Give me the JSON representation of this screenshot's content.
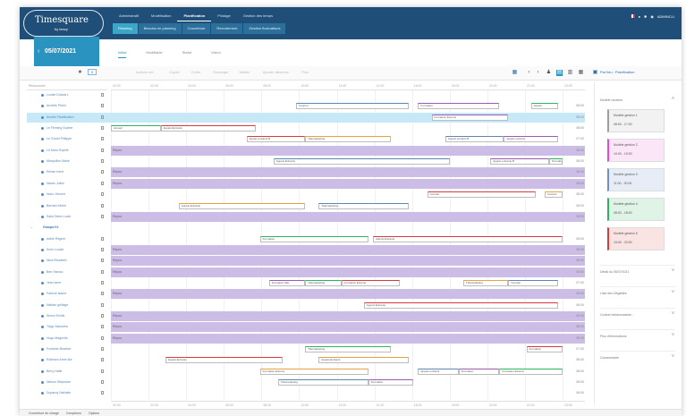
{
  "app": {
    "logo_title": "Timesquare",
    "logo_sub": "by tenzy"
  },
  "main_nav": [
    "Administratif",
    "Modélisation",
    "Planification",
    "Pilotage",
    "Gestion des temps"
  ],
  "main_nav_active": 2,
  "sub_nav": [
    "Planning",
    "Besoins en planning",
    "Couverture",
    "Recrutement",
    "Gestion fluctuations"
  ],
  "sub_nav_active": 0,
  "top_right": {
    "user": "ADMINCLI"
  },
  "date_box": {
    "date": "05/07/2021"
  },
  "view_tabs": [
    "Initial",
    "Modifiable",
    "Statut",
    "Vision"
  ],
  "view_tabs_active": 0,
  "toolbar": {
    "zoom": "5",
    "items": [
      "Actions sel.",
      "Copier",
      "Coller",
      "Echanger",
      "Valider",
      "Ajouter absence",
      "Plus"
    ],
    "right_filter": "Par lieu : Planification"
  },
  "header": {
    "resources_label": "Ressources",
    "ticks": [
      "00:00",
      "02:00",
      "04:00",
      "06:00",
      "08:00",
      "10:00",
      "12:00",
      "14:00",
      "16:00",
      "18:00",
      "20:00",
      "22:00",
      "23:59"
    ]
  },
  "resources": [
    {
      "name": "Louise Dubois L",
      "type": "person"
    },
    {
      "name": "Armelle Peres",
      "type": "person"
    },
    {
      "name": "Amélie Planification",
      "type": "person",
      "selected": true
    },
    {
      "name": "Le Fleming Sophie",
      "type": "person"
    },
    {
      "name": "Le Grand Philippe",
      "type": "person"
    },
    {
      "name": "Le Maro Sophie",
      "type": "person"
    },
    {
      "name": "Marquillon Marie",
      "type": "person"
    },
    {
      "name": "Renan Irène",
      "type": "person"
    },
    {
      "name": "Naves Julien",
      "type": "person"
    },
    {
      "name": "Noiro Vincent",
      "type": "person"
    },
    {
      "name": "Bernard Marie",
      "type": "person"
    },
    {
      "name": "Saint Denis Lucie",
      "type": "person"
    },
    {
      "name": "Groupe 01",
      "type": "group"
    },
    {
      "name": "Adèle Régine",
      "type": "person"
    },
    {
      "name": "Sven Louise",
      "type": "person"
    },
    {
      "name": "Nina Elisabeth",
      "type": "person"
    },
    {
      "name": "Ben Hamou",
      "type": "person"
    },
    {
      "name": "Jean Isere",
      "type": "person"
    },
    {
      "name": "Fabrice Isaure",
      "type": "person"
    },
    {
      "name": "Nathan grilliage",
      "type": "person"
    },
    {
      "name": "Simon Emilie",
      "type": "person"
    },
    {
      "name": "Tiago Manuella",
      "type": "person"
    },
    {
      "name": "Hugo Magnolia",
      "type": "person"
    },
    {
      "name": "Fontaine Béatrice",
      "type": "person"
    },
    {
      "name": "Rolleaux Anne Ma",
      "type": "person"
    },
    {
      "name": "Berry Halle",
      "type": "person"
    },
    {
      "name": "Nelson Stéphane",
      "type": "person"
    },
    {
      "name": "Duparcq Nathalie",
      "type": "person"
    }
  ],
  "rows": [
    {
      "hours": "",
      "band": "none",
      "events": []
    },
    {
      "hours": "08:00",
      "band": "none",
      "events": [
        {
          "label": "Courrier",
          "s": 0.41,
          "e": 0.66
        },
        {
          "label": "Formation",
          "s": 0.68,
          "e": 0.86
        },
        {
          "label": "Appels",
          "s": 0.93,
          "e": 0.99
        }
      ]
    },
    {
      "hours": "08:00",
      "band": "sel",
      "events": [
        {
          "label": "Formation Externe",
          "s": 0.71,
          "e": 0.88
        }
      ]
    },
    {
      "hours": "08:00",
      "band": "none",
      "events": [
        {
          "label": "Accueil",
          "s": 0.0,
          "e": 0.11
        },
        {
          "label": "Appels Entrants",
          "s": 0.11,
          "e": 0.32
        }
      ]
    },
    {
      "hours": "07:00",
      "band": "none",
      "events": [
        {
          "label": "Appels entrants B",
          "s": 0.3,
          "e": 0.43
        },
        {
          "label": "Télémarketing",
          "s": 0.43,
          "e": 0.62
        },
        {
          "label": "Appels entrants B",
          "s": 0.74,
          "e": 0.87
        },
        {
          "label": "Appels entrants",
          "s": 0.87,
          "e": 0.99
        }
      ]
    },
    {
      "hours": "08:00",
      "band": "purple",
      "events": [],
      "repos": "Repos"
    },
    {
      "hours": "08:00",
      "band": "none",
      "events": [
        {
          "label": "Appels Entrants",
          "s": 0.36,
          "e": 0.75
        },
        {
          "label": "Appels entrants B",
          "s": 0.84,
          "e": 0.97
        },
        {
          "label": "Formation",
          "s": 0.97,
          "e": 1.0
        }
      ]
    },
    {
      "hours": "08:00",
      "band": "purple",
      "events": [],
      "repos": "Repos"
    },
    {
      "hours": "08:00",
      "band": "purple",
      "events": [],
      "repos": "Repos"
    },
    {
      "hours": "08:00",
      "band": "none",
      "events": [
        {
          "label": "Courrier",
          "s": 0.7,
          "e": 0.94
        },
        {
          "label": "Courrier",
          "s": 0.96,
          "e": 1.0
        }
      ]
    },
    {
      "hours": "08:00",
      "band": "none",
      "events": [
        {
          "label": "Appels Entrants",
          "s": 0.15,
          "e": 0.43
        },
        {
          "label": "Télémarketing",
          "s": 0.46,
          "e": 0.66
        }
      ]
    },
    {
      "hours": "08:00",
      "band": "purple",
      "events": [],
      "repos": "Repos"
    },
    {
      "hours": "",
      "band": "none",
      "events": []
    },
    {
      "hours": "08:00",
      "band": "none",
      "events": [
        {
          "label": "Formation",
          "s": 0.33,
          "e": 0.57
        },
        {
          "label": "Appels Entrants",
          "s": 0.58,
          "e": 1.0
        }
      ]
    },
    {
      "hours": "08:00",
      "band": "purple",
      "events": [],
      "repos": "Repos"
    },
    {
      "hours": "08:00",
      "band": "purple",
      "events": [],
      "repos": "Repos"
    },
    {
      "hours": "08:00",
      "band": "purple",
      "events": [],
      "repos": "Repos"
    },
    {
      "hours": "07:00",
      "band": "none",
      "events": [
        {
          "label": "Formation Mét.",
          "s": 0.35,
          "e": 0.43
        },
        {
          "label": "Télémarketing",
          "s": 0.43,
          "e": 0.51
        },
        {
          "label": "Formation Externe",
          "s": 0.51,
          "e": 0.64
        },
        {
          "label": "Télémarketing",
          "s": 0.78,
          "e": 0.88
        },
        {
          "label": "Courrier",
          "s": 0.88,
          "e": 0.99
        }
      ]
    },
    {
      "hours": "08:00",
      "band": "purple",
      "events": [],
      "repos": "Repos"
    },
    {
      "hours": "08:00",
      "band": "none",
      "events": [
        {
          "label": "Appels Entrants",
          "s": 0.56,
          "e": 0.99
        }
      ]
    },
    {
      "hours": "08:00",
      "band": "purple",
      "events": [],
      "repos": "Repos"
    },
    {
      "hours": "08:00",
      "band": "purple",
      "events": [],
      "repos": "Repos"
    },
    {
      "hours": "08:00",
      "band": "purple",
      "events": [],
      "repos": "Repos"
    },
    {
      "hours": "07:00",
      "band": "none",
      "events": [
        {
          "label": "Télémarketing",
          "s": 0.43,
          "e": 0.62
        },
        {
          "label": "Formation",
          "s": 0.92,
          "e": 1.0
        }
      ]
    },
    {
      "hours": "08:00",
      "band": "none",
      "events": [
        {
          "label": "Appels Entrants",
          "s": 0.12,
          "e": 0.38
        },
        {
          "label": "Appels Entrants",
          "s": 0.46,
          "e": 0.66
        }
      ]
    },
    {
      "hours": "08:00",
      "band": "none",
      "events": [
        {
          "label": "Formation Externe",
          "s": 0.33,
          "e": 0.57
        },
        {
          "label": "Appels entrants",
          "s": 0.68,
          "e": 0.77
        },
        {
          "label": "Formation",
          "s": 0.77,
          "e": 0.86
        },
        {
          "label": "Formation Externe",
          "s": 0.86,
          "e": 1.0
        }
      ]
    },
    {
      "hours": "08:00",
      "band": "none",
      "events": [
        {
          "label": "Télémarketing",
          "s": 0.37,
          "e": 0.57
        },
        {
          "label": "Formation",
          "s": 0.57,
          "e": 0.67
        }
      ]
    },
    {
      "hours": "08:00",
      "band": "none",
      "events": []
    }
  ],
  "right_panel": {
    "title": "Modèle horaires",
    "cards": [
      {
        "name": "Modèle gestion 1",
        "time": "08:00 - 17:00",
        "color": "#9e9e9e",
        "bg": "#f2f2f2"
      },
      {
        "name": "Modèle gestion 2",
        "time": "10:00 - 19:00",
        "color": "#e04ad6",
        "bg": "#fbe6f8"
      },
      {
        "name": "Modèle gestion 3",
        "time": "11:00 - 20:00",
        "color": "#6f8fc7",
        "bg": "#e7edf7"
      },
      {
        "name": "Modèle gestion 4",
        "time": "08:00 - 18:00",
        "color": "#2fb15f",
        "bg": "#dff3e7"
      },
      {
        "name": "Modèle gestion 5",
        "time": "15:00 - 20:00",
        "color": "#d83a3a",
        "bg": "#fae3e3"
      }
    ],
    "sections": [
      "Détail du 05/07/2021",
      "Liste des Dégalités",
      "Contrat hebdomadaire...",
      "Plus d'informations",
      "Commentaire"
    ]
  },
  "status_bar": [
    "Couverture de charge",
    "Compteurs",
    "Options"
  ]
}
